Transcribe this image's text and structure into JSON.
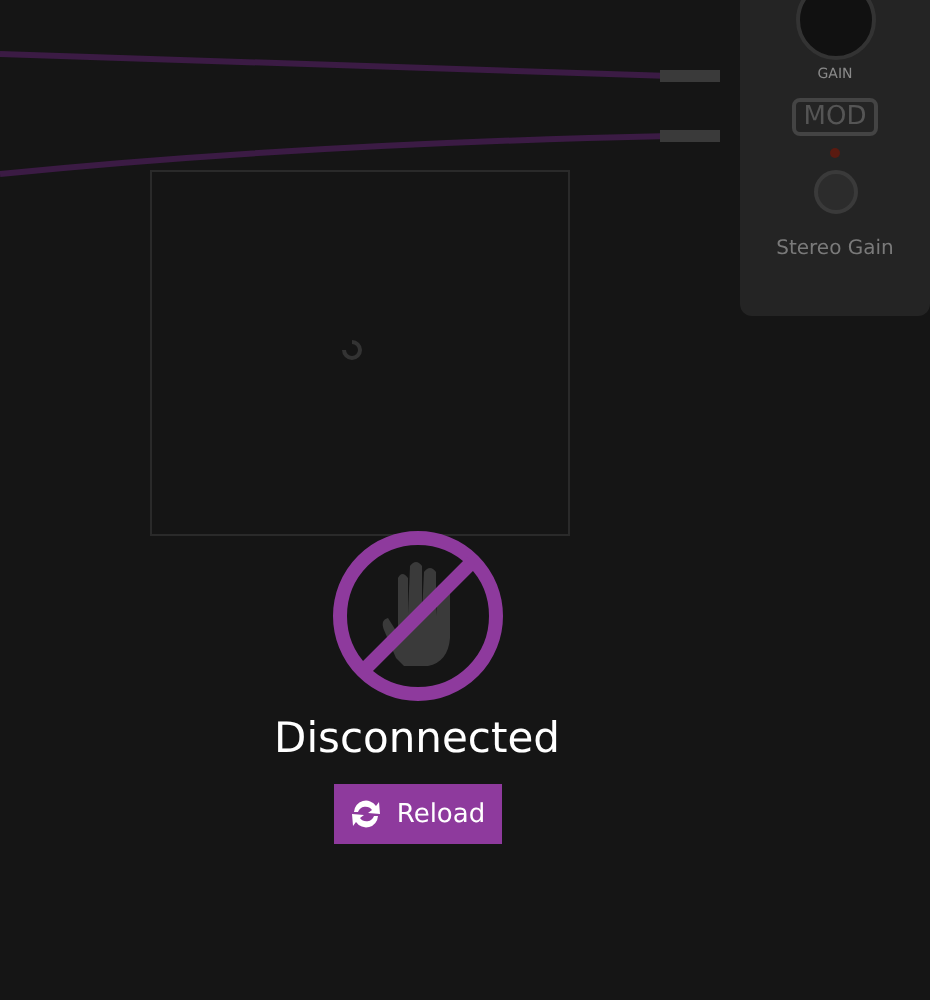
{
  "pedal": {
    "knob_label": "GAIN",
    "logo": "MOD",
    "name": "Stereo Gain"
  },
  "status": {
    "message": "Disconnected",
    "button": "Reload"
  }
}
